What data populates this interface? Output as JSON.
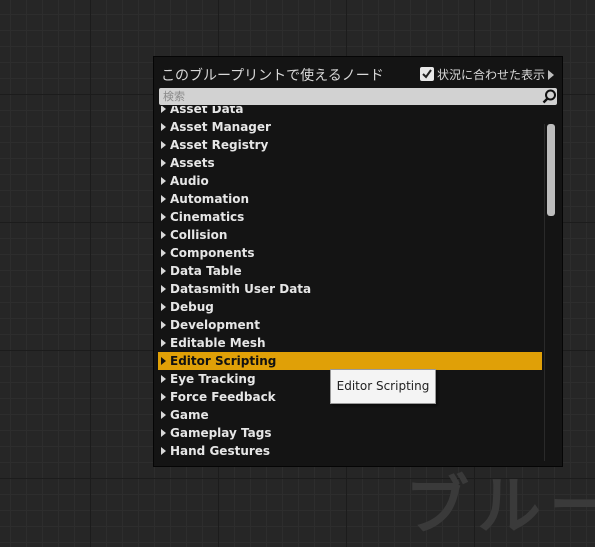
{
  "watermark": {
    "text": "ブルー"
  },
  "panel": {
    "title": "このブループリントで使えるノード",
    "context_sensitive": {
      "label": "状況に合わせた表示",
      "checked": true
    },
    "search": {
      "placeholder": "検索",
      "value": ""
    },
    "categories": [
      {
        "label": "Asset Data",
        "selected": false
      },
      {
        "label": "Asset Manager",
        "selected": false
      },
      {
        "label": "Asset Registry",
        "selected": false
      },
      {
        "label": "Assets",
        "selected": false
      },
      {
        "label": "Audio",
        "selected": false
      },
      {
        "label": "Automation",
        "selected": false
      },
      {
        "label": "Cinematics",
        "selected": false
      },
      {
        "label": "Collision",
        "selected": false
      },
      {
        "label": "Components",
        "selected": false
      },
      {
        "label": "Data Table",
        "selected": false
      },
      {
        "label": "Datasmith User Data",
        "selected": false
      },
      {
        "label": "Debug",
        "selected": false
      },
      {
        "label": "Development",
        "selected": false
      },
      {
        "label": "Editable Mesh",
        "selected": false
      },
      {
        "label": "Editor Scripting",
        "selected": true
      },
      {
        "label": "Eye Tracking",
        "selected": false
      },
      {
        "label": "Force Feedback",
        "selected": false
      },
      {
        "label": "Game",
        "selected": false
      },
      {
        "label": "Gameplay Tags",
        "selected": false
      },
      {
        "label": "Hand Gestures",
        "selected": false
      }
    ]
  },
  "tooltip": {
    "text": "Editor Scripting"
  },
  "colors": {
    "selection": "#e0a007",
    "panel_bg": "#141414",
    "graph_bg": "#262626"
  }
}
